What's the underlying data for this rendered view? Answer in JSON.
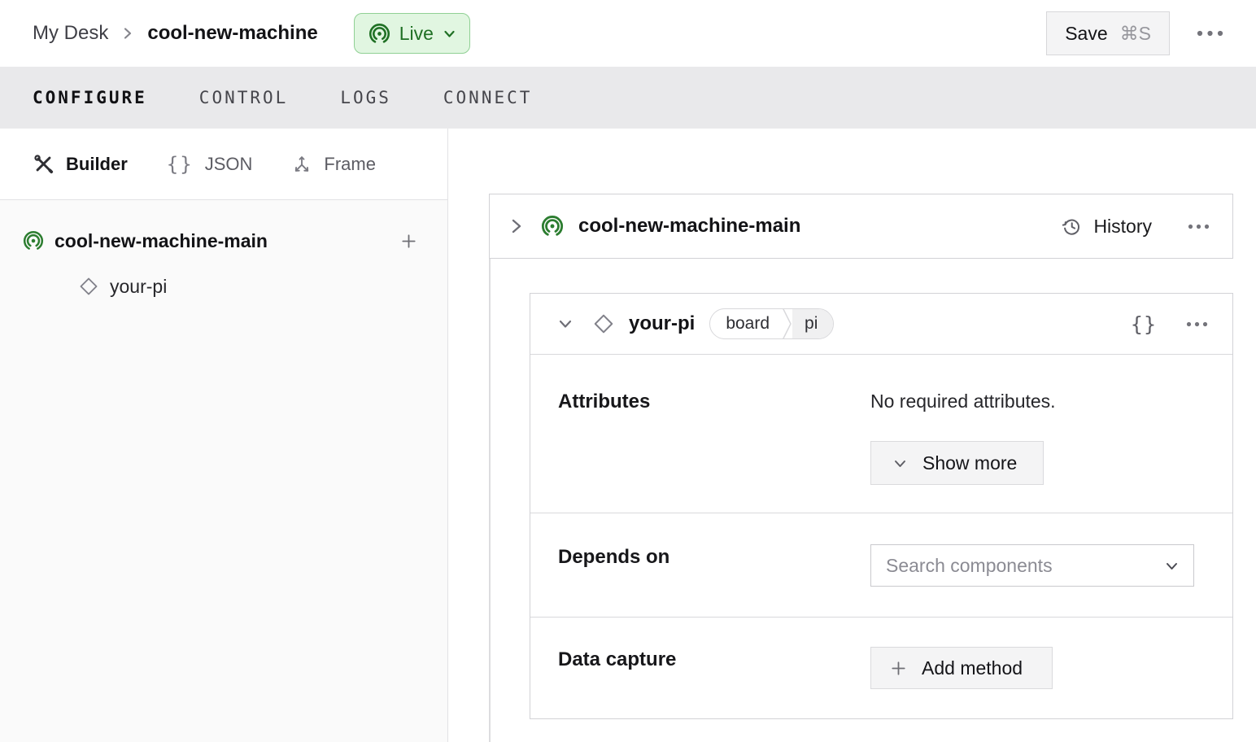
{
  "header": {
    "breadcrumb": {
      "parent": "My Desk",
      "current": "cool-new-machine"
    },
    "live_badge": {
      "label": "Live"
    },
    "save_button": {
      "label": "Save",
      "shortcut": "⌘S"
    }
  },
  "nav_tabs": [
    {
      "label": "CONFIGURE",
      "active": true
    },
    {
      "label": "CONTROL",
      "active": false
    },
    {
      "label": "LOGS",
      "active": false
    },
    {
      "label": "CONNECT",
      "active": false
    }
  ],
  "sidebar": {
    "view_tabs": [
      {
        "label": "Builder",
        "icon": "tools-icon",
        "active": true
      },
      {
        "label": "JSON",
        "icon": "braces-icon",
        "active": false
      },
      {
        "label": "Frame",
        "icon": "frame-axes-icon",
        "active": false
      }
    ],
    "tree": {
      "machine_part": {
        "label": "cool-new-machine-main",
        "icon": "broadcast-icon"
      },
      "components": [
        {
          "label": "your-pi",
          "icon": "diamond-icon"
        }
      ]
    }
  },
  "main": {
    "part_card": {
      "title": "cool-new-machine-main",
      "history_label": "History"
    },
    "component_card": {
      "title": "your-pi",
      "badges": [
        "board",
        "pi"
      ],
      "attributes": {
        "label": "Attributes",
        "empty_text": "No required attributes.",
        "show_more_label": "Show more"
      },
      "depends_on": {
        "label": "Depends on",
        "search_placeholder": "Search components"
      },
      "data_capture": {
        "label": "Data capture",
        "add_method_label": "Add method"
      }
    }
  },
  "icons": {
    "braces_glyph": "{}"
  },
  "colors": {
    "accent_green": "#2c7d30",
    "live_badge_bg": "#e1f6e1",
    "live_badge_border": "#90d094",
    "tabbar_bg": "#e9e9eb",
    "sidebar_bg": "#fafafa",
    "card_border": "#d2d2d6",
    "button_bg": "#f4f4f5",
    "placeholder_text": "#8b8b93"
  }
}
